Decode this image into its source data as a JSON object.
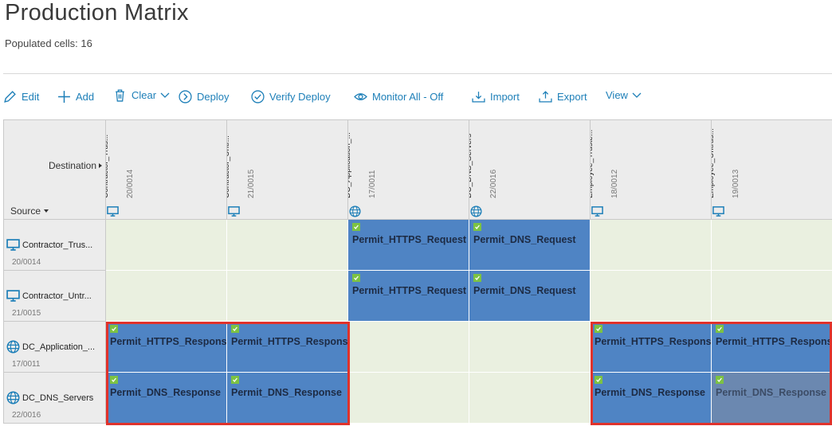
{
  "page": {
    "title": "Production Matrix",
    "populated_cells": "Populated cells: 16"
  },
  "toolbar": {
    "edit": "Edit",
    "add": "Add",
    "clear": "Clear",
    "deploy": "Deploy",
    "verify_deploy": "Verify Deploy",
    "monitor_all": "Monitor All - Off",
    "import": "Import",
    "export": "Export",
    "view": "View"
  },
  "matrix": {
    "destination_label": "Destination",
    "source_label": "Source",
    "columns": [
      {
        "name": "Contractor_Trus...",
        "id": "20/0014",
        "icon": "monitor-icon"
      },
      {
        "name": "Contractor_Untr...",
        "id": "21/0015",
        "icon": "monitor-icon"
      },
      {
        "name": "DC_Application_...",
        "id": "17/0011",
        "icon": "globe-icon"
      },
      {
        "name": "DC_DNS_Servers",
        "id": "22/0016",
        "icon": "globe-icon"
      },
      {
        "name": "Employee_Truste...",
        "id": "18/0012",
        "icon": "monitor-icon"
      },
      {
        "name": "Employee_Untrus...",
        "id": "19/0013",
        "icon": "monitor-icon"
      }
    ],
    "rows": [
      {
        "name": "Contractor_Trus...",
        "id": "20/0014",
        "icon": "monitor-icon",
        "cells": [
          "",
          "",
          "Permit_HTTPS_Request",
          "Permit_DNS_Request",
          "",
          ""
        ]
      },
      {
        "name": "Contractor_Untr...",
        "id": "21/0015",
        "icon": "monitor-icon",
        "cells": [
          "",
          "",
          "Permit_HTTPS_Request",
          "Permit_DNS_Request",
          "",
          ""
        ]
      },
      {
        "name": "DC_Application_...",
        "id": "17/0011",
        "icon": "globe-icon",
        "cells": [
          "Permit_HTTPS_Response",
          "Permit_HTTPS_Response",
          "",
          "",
          "Permit_HTTPS_Response",
          "Permit_HTTPS_Response"
        ]
      },
      {
        "name": "DC_DNS_Servers",
        "id": "22/0016",
        "icon": "globe-icon",
        "cells": [
          "Permit_DNS_Response",
          "Permit_DNS_Response",
          "",
          "",
          "Permit_DNS_Response",
          "Permit_DNS_Response"
        ]
      }
    ],
    "dimmed_cell": {
      "row": 3,
      "col": 5
    }
  },
  "colors": {
    "accent": "#1d7fb8",
    "cell_filled": "#4f84c4",
    "cell_empty": "#eaf0e0",
    "selection": "#e0322b",
    "check": "#7cc243"
  }
}
